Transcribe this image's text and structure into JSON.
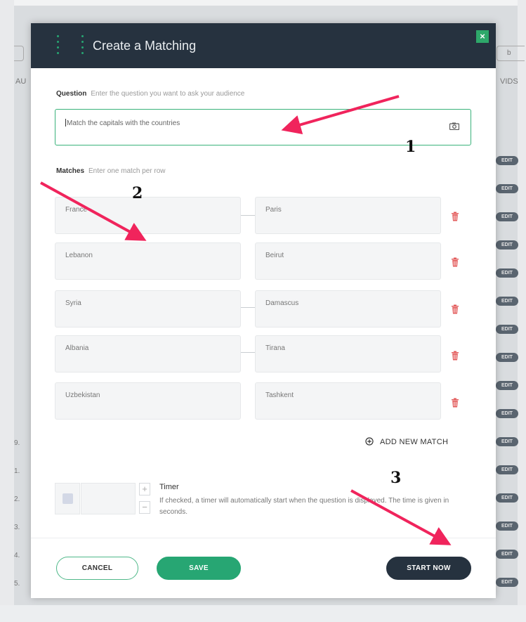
{
  "background": {
    "left_label": "AU",
    "right_label": "VIDS",
    "right_input_text": "b",
    "pill_label": "EDIT",
    "row_numbers": [
      "9.",
      "1.",
      "2.",
      "3.",
      "4.",
      "5."
    ]
  },
  "modal": {
    "title": "Create a Matching",
    "close_glyph": "×",
    "question": {
      "label": "Question",
      "hint": "Enter the question you want to ask your audience",
      "value": "Match the capitals with the countries"
    },
    "matches": {
      "label": "Matches",
      "hint": "Enter one match per row",
      "pairs": [
        {
          "left": "France",
          "right": "Paris"
        },
        {
          "left": "Lebanon",
          "right": "Beirut"
        },
        {
          "left": "Syria",
          "right": "Damascus"
        },
        {
          "left": "Albania",
          "right": "Tirana"
        },
        {
          "left": "Uzbekistan",
          "right": "Tashkent"
        }
      ]
    },
    "add_match_label": "ADD NEW MATCH",
    "timer": {
      "label": "Timer",
      "description": "If checked, a timer will automatically start when the question is displayed. The time is given in seconds.",
      "value": "",
      "plus_glyph": "+",
      "minus_glyph": "−"
    },
    "buttons": {
      "cancel": "CANCEL",
      "save": "SAVE",
      "start": "START NOW"
    },
    "accent_color": "#27a673",
    "header_color": "#26323f"
  },
  "annotations": {
    "labels": [
      "1",
      "2",
      "3"
    ],
    "arrow_color": "#f0245c"
  }
}
